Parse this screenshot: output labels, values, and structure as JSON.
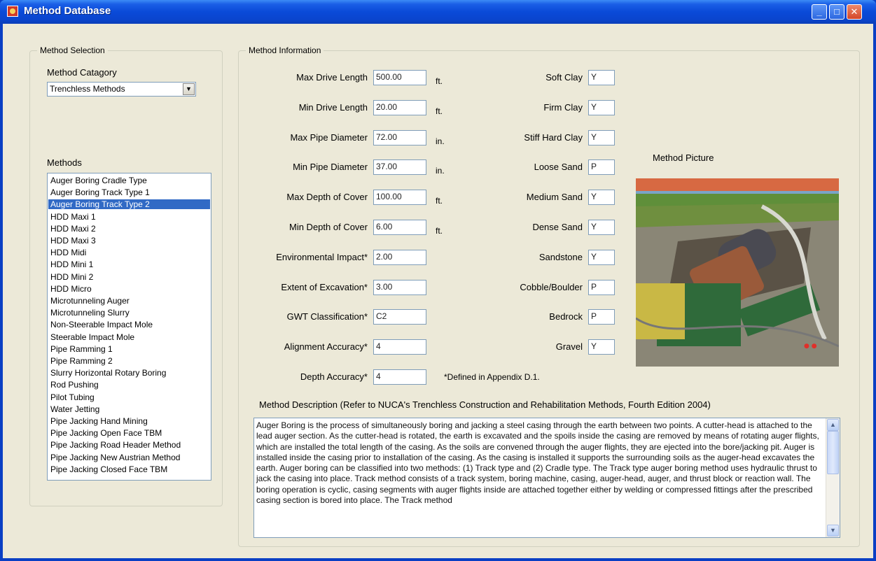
{
  "window": {
    "title": "Method Database"
  },
  "method_selection": {
    "caption": "Method Selection",
    "category_label": "Method Catagory",
    "category_value": "Trenchless Methods",
    "methods_label": "Methods",
    "methods": [
      "Auger Boring Cradle Type",
      "Auger Boring Track Type 1",
      "Auger Boring Track Type 2",
      "HDD Maxi 1",
      "HDD Maxi 2",
      "HDD Maxi 3",
      "HDD Midi",
      "HDD Mini 1",
      "HDD Mini 2",
      "HDD Micro",
      "Microtunneling Auger",
      "Microtunneling Slurry",
      "Non-Steerable Impact Mole",
      "Steerable Impact Mole",
      "Pipe Ramming 1",
      "Pipe Ramming 2",
      "Slurry Horizontal Rotary Boring",
      "Rod Pushing",
      "Pilot Tubing",
      "Water Jetting",
      "Pipe Jacking Hand Mining",
      "Pipe Jacking Open Face TBM",
      "Pipe Jacking Road Header Method",
      "Pipe Jacking New Austrian Method",
      "Pipe Jacking Closed Face TBM"
    ],
    "selected_method": "Auger Boring Track Type 2"
  },
  "method_info": {
    "caption": "Method Information",
    "fields": [
      {
        "label": "Max Drive Length",
        "value": "500.00",
        "unit": "ft."
      },
      {
        "label": "Min Drive Length",
        "value": "20.00",
        "unit": "ft."
      },
      {
        "label": "Max Pipe Diameter",
        "value": "72.00",
        "unit": "in."
      },
      {
        "label": "Min Pipe Diameter",
        "value": "37.00",
        "unit": "in."
      },
      {
        "label": "Max Depth of Cover",
        "value": "100.00",
        "unit": "ft."
      },
      {
        "label": "Min Depth of Cover",
        "value": "6.00",
        "unit": "ft."
      },
      {
        "label": "Environmental Impact*",
        "value": "2.00",
        "unit": ""
      },
      {
        "label": "Extent of Excavation*",
        "value": "3.00",
        "unit": ""
      },
      {
        "label": "GWT Classification*",
        "value": "C2",
        "unit": ""
      },
      {
        "label": "Alignment Accuracy*",
        "value": "4",
        "unit": ""
      },
      {
        "label": "Depth Accuracy*",
        "value": "4",
        "unit": ""
      }
    ],
    "footnote": "*Defined in Appendix D.1.",
    "soils": [
      {
        "label": "Soft Clay",
        "value": "Y"
      },
      {
        "label": "Firm Clay",
        "value": "Y"
      },
      {
        "label": "Stiff Hard Clay",
        "value": "Y"
      },
      {
        "label": "Loose Sand",
        "value": "P"
      },
      {
        "label": "Medium Sand",
        "value": "Y"
      },
      {
        "label": "Dense Sand",
        "value": "Y"
      },
      {
        "label": "Sandstone",
        "value": "Y"
      },
      {
        "label": "Cobble/Boulder",
        "value": "P"
      },
      {
        "label": "Bedrock",
        "value": "P"
      },
      {
        "label": "Gravel",
        "value": "Y"
      }
    ],
    "picture_label": "Method Picture",
    "description_label": "Method Description (Refer to NUCA's Trenchless Construction and Rehabilitation Methods, Fourth Edition 2004)",
    "description": "Auger Boring is the process of simultaneously boring and jacking a steel casing through the earth between two points. A cutter-head is attached to the lead auger section. As the cutter-head is rotated, the earth is excavated and the spoils inside the casing are removed by means of rotating auger flights, which are installed the total length of the casing. As the soils are convened through the auger flights, they are ejected into the bore/jacking pit. Auger is installed inside the casing prior to installation of the casing. As the casing is installed it supports the surrounding soils as the auger-head excavates the earth. Auger boring can be classified into two methods: (1) Track type and (2) Cradle type. The Track type auger boring method uses hydraulic thrust to jack the casing into place. Track method consists of a track system, boring machine, casing, auger-head, auger, and thrust block or reaction wall. The boring operation is cyclic, casing segments with auger flights inside are attached together either by welding or compressed fittings after the prescribed casing section is bored into place. The Track method"
  },
  "colors": {
    "title_bar": "#0a4ad8",
    "client_bg": "#ece9d8",
    "selection": "#316ac5"
  }
}
